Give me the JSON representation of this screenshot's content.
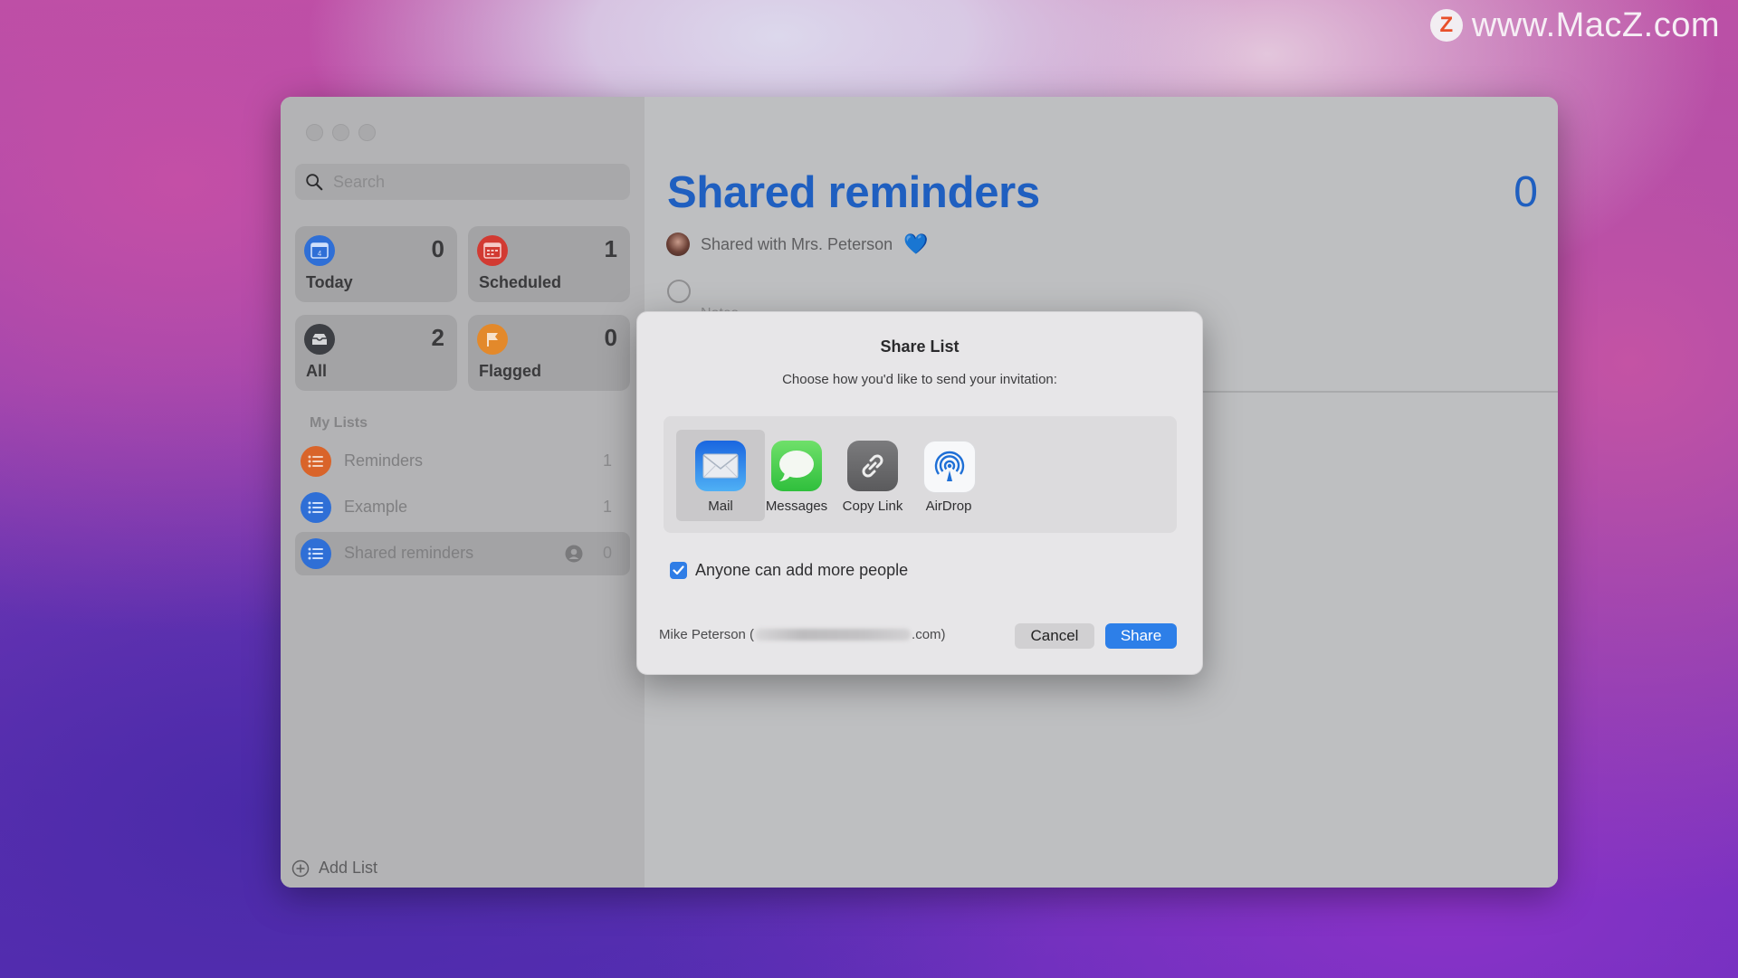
{
  "watermark": {
    "logo_letter": "Z",
    "text": "www.MacZ.com"
  },
  "sidebar": {
    "search": {
      "placeholder": "Search"
    },
    "smart_lists": [
      {
        "label": "Today",
        "count": "0",
        "color": "#2f6fd6"
      },
      {
        "label": "Scheduled",
        "count": "1",
        "color": "#d23a32"
      },
      {
        "label": "All",
        "count": "2",
        "color": "#3d3f44"
      },
      {
        "label": "Flagged",
        "count": "0",
        "color": "#e3892b"
      }
    ],
    "section_label": "My Lists",
    "lists": [
      {
        "label": "Reminders",
        "count": "1",
        "color": "#d9642a",
        "shared": false,
        "selected": false
      },
      {
        "label": "Example",
        "count": "1",
        "color": "#2f6fd6",
        "shared": false,
        "selected": false
      },
      {
        "label": "Shared reminders",
        "count": "0",
        "color": "#2f6fd6",
        "shared": true,
        "selected": true
      }
    ],
    "add_list_label": "Add List"
  },
  "main": {
    "title": "Shared reminders",
    "count": "0",
    "shared_with": "Shared with Mrs. Peterson",
    "heart": "💙",
    "notes_placeholder": "Notes",
    "accent_color": "#1f5fc0"
  },
  "dialog": {
    "title": "Share List",
    "subtitle": "Choose how you'd like to send your invitation:",
    "options": [
      {
        "label": "Mail",
        "icon": "mail-icon",
        "selected": true
      },
      {
        "label": "Messages",
        "icon": "messages-icon",
        "selected": false
      },
      {
        "label": "Copy Link",
        "icon": "link-icon",
        "selected": false
      },
      {
        "label": "AirDrop",
        "icon": "airdrop-icon",
        "selected": false
      }
    ],
    "checkbox": {
      "label": "Anyone can add more people",
      "checked": true
    },
    "owner_name": "Mike Peterson (",
    "owner_email_suffix": ".com)",
    "cancel_label": "Cancel",
    "share_label": "Share",
    "share_color": "#2d7fe8"
  }
}
